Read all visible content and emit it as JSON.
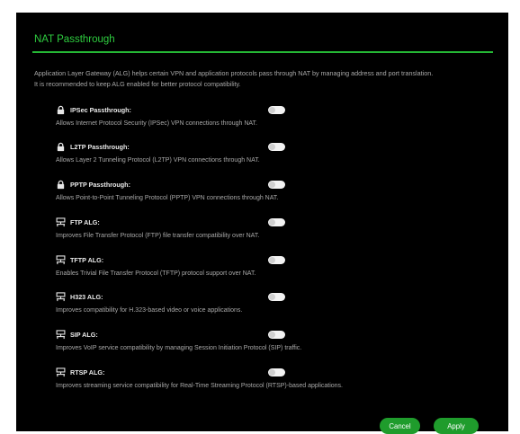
{
  "section": {
    "title": "NAT Passthrough",
    "description_line1": "Application Layer Gateway (ALG) helps certain VPN and application protocols pass through NAT by managing address and port translation.",
    "description_line2": "It is recommended to keep ALG enabled for better protocol compatibility."
  },
  "items": [
    {
      "icon": "lock-icon",
      "label": "IPSec Passthrough:",
      "description": "Allows Internet Protocol Security (IPSec) VPN connections through NAT.",
      "enabled": false
    },
    {
      "icon": "lock-icon",
      "label": "L2TP Passthrough:",
      "description": "Allows Layer 2 Tunneling Protocol (L2TP) VPN connections through NAT.",
      "enabled": false
    },
    {
      "icon": "lock-icon",
      "label": "PPTP Passthrough:",
      "description": "Allows Point-to-Point Tunneling Protocol (PPTP) VPN connections through NAT.",
      "enabled": false
    },
    {
      "icon": "network-icon",
      "label": "FTP ALG:",
      "description": "Improves File Transfer Protocol (FTP) file transfer compatibility over NAT.",
      "enabled": false
    },
    {
      "icon": "network-icon",
      "label": "TFTP ALG:",
      "description": "Enables Trivial File Transfer Protocol (TFTP) protocol support over NAT.",
      "enabled": false
    },
    {
      "icon": "network-icon",
      "label": "H323 ALG:",
      "description": "Improves compatibility for H.323-based video or voice applications.",
      "enabled": false
    },
    {
      "icon": "network-icon",
      "label": "SIP ALG:",
      "description": "Improves VoIP service compatibility by managing Session Initiation Protocol (SIP) traffic.",
      "enabled": false
    },
    {
      "icon": "network-icon",
      "label": "RTSP ALG:",
      "description": "Improves streaming service compatibility for Real-Time Streaming Protocol (RTSP)-based applications.",
      "enabled": false
    }
  ],
  "buttons": {
    "cancel_label": "Cancel",
    "apply_label": "Apply"
  },
  "colors": {
    "accent": "#2ecc3f",
    "button": "#1f9c2c",
    "background": "#000000"
  }
}
